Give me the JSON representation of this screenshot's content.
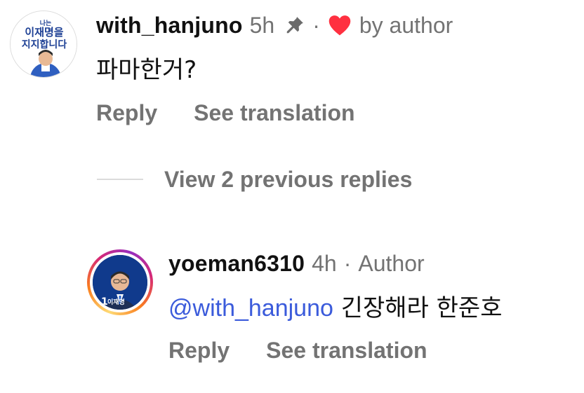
{
  "comment": {
    "username": "with_hanjuno",
    "time": "5h",
    "separator": "·",
    "liked_by_author": "by author",
    "text": "파마한거?",
    "avatar_text_small": "나는",
    "avatar_text_line1": "이재명을",
    "avatar_text_line2": "지지합니다",
    "actions": {
      "reply": "Reply",
      "translate": "See translation"
    }
  },
  "view_replies": {
    "label": "View 2 previous replies"
  },
  "reply": {
    "username": "yoeman6310",
    "time": "4h",
    "separator": "·",
    "author_label": "Author",
    "mention": "@with_hanjuno",
    "text": " 긴장해라 한준호",
    "avatar_badge_number": "1",
    "avatar_badge_text": "이재명",
    "actions": {
      "reply": "Reply",
      "translate": "See translation"
    }
  },
  "colors": {
    "heart": "#ff3040",
    "mention": "#3b5bdb",
    "secondary_text": "#737373",
    "avatar_blue": "#103a8c"
  },
  "icons": {
    "pin": "pin-icon",
    "heart": "heart-icon"
  }
}
